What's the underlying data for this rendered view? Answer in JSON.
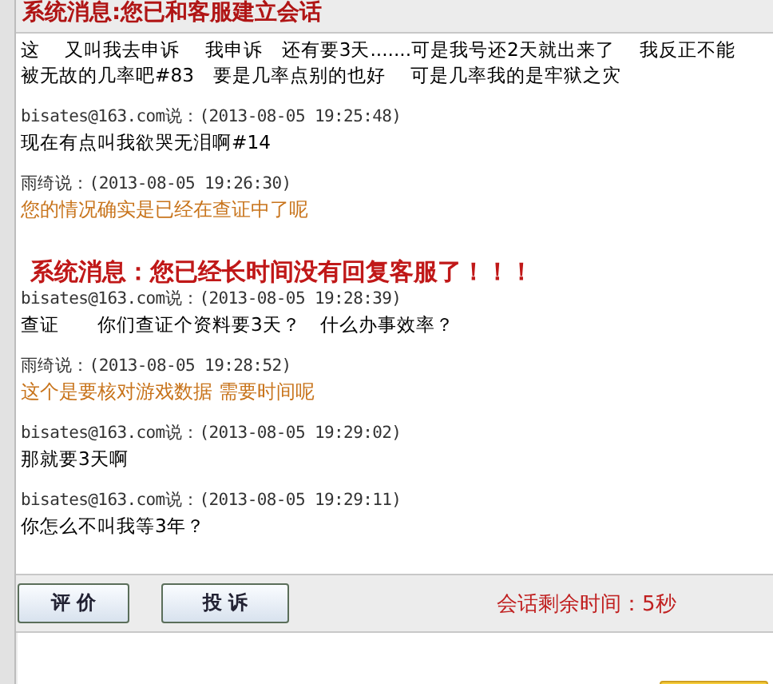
{
  "banner": {
    "text": "系统消息:您已和客服建立会话"
  },
  "messages": [
    {
      "kind": "text",
      "text": "这　 又叫我去申诉　 我申诉　还有要3天.......可是我号还2天就出来了　 我反正不能"
    },
    {
      "kind": "text",
      "text": "被无故的几率吧#83　要是几率点别的也好　 可是几率我的是牢狱之灾"
    },
    {
      "kind": "header",
      "text": "bisates@163.com说：(2013-08-05 19:25:48)"
    },
    {
      "kind": "text",
      "text": "现在有点叫我欲哭无泪啊#14"
    },
    {
      "kind": "header",
      "text": "雨绮说：(2013-08-05 19:26:30)"
    },
    {
      "kind": "reply",
      "text": "您的情况确实是已经在查证中了呢"
    },
    {
      "kind": "system",
      "text": "系统消息：您已经长时间没有回复客服了！！！"
    },
    {
      "kind": "header",
      "text": "bisates@163.com说：(2013-08-05 19:28:39)"
    },
    {
      "kind": "text",
      "text": "查证　　你们查证个资料要3天？　什么办事效率？"
    },
    {
      "kind": "header",
      "text": "雨绮说：(2013-08-05 19:28:52)"
    },
    {
      "kind": "reply",
      "text": "这个是要核对游戏数据 需要时间呢"
    },
    {
      "kind": "header",
      "text": "bisates@163.com说：(2013-08-05 19:29:02)"
    },
    {
      "kind": "text",
      "text": "那就要3天啊"
    },
    {
      "kind": "header",
      "text": "bisates@163.com说：(2013-08-05 19:29:11)"
    },
    {
      "kind": "text",
      "text": "你怎么不叫我等3年？"
    }
  ],
  "buttons": [
    "评 价",
    "投 诉"
  ],
  "timer": "会话剩余时间：5秒"
}
